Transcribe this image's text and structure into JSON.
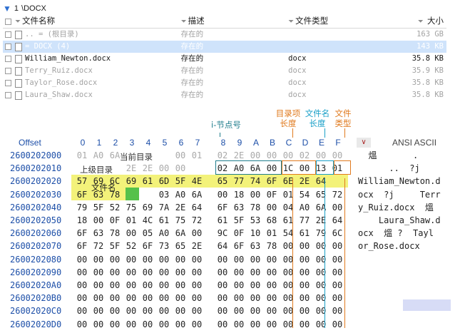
{
  "path": {
    "count": "1",
    "dir": "\\DOCX"
  },
  "list": {
    "headers": {
      "name": "文件名称",
      "desc": "描述",
      "type": "文件类型",
      "size": "大小"
    },
    "rows": [
      {
        "name": ".. = (根目录)",
        "desc": "存在的",
        "type": "",
        "size": "163 GB",
        "style": "grey"
      },
      {
        "name": "= DOCX (4)",
        "desc": "存在的",
        "type": "",
        "size": "143 KB",
        "style": "sel"
      },
      {
        "name": "William_Newton.docx",
        "desc": "存在的",
        "type": "docx",
        "size": "35.8 KB",
        "style": "normal"
      },
      {
        "name": "Terry_Ruiz.docx",
        "desc": "存在的",
        "type": "docx",
        "size": "35.9 KB",
        "style": "grey"
      },
      {
        "name": "Taylor_Rose.docx",
        "desc": "存在的",
        "type": "docx",
        "size": "35.8 KB",
        "style": "grey"
      },
      {
        "name": "Laura_Shaw.docx",
        "desc": "存在的",
        "type": "docx",
        "size": "35.8 KB",
        "style": "grey"
      }
    ]
  },
  "hex": {
    "offset_label": "Offset",
    "columns": [
      "0",
      "1",
      "2",
      "3",
      "4",
      "5",
      "6",
      "7",
      "8",
      "9",
      "A",
      "B",
      "C",
      "D",
      "E",
      "F"
    ],
    "ansi_label": "ANSI ASCII",
    "view_label": "∨",
    "rows": [
      {
        "addr": "2600202000",
        "bytes": [
          "01",
          "A0",
          "6A",
          "",
          "",
          "",
          "00",
          "01",
          "02",
          "2E",
          "00",
          "00",
          "00",
          "02",
          "00",
          "00"
        ]
      },
      {
        "addr": "2600202010",
        "bytes": [
          "",
          "",
          "",
          "2E",
          "2E",
          "00",
          "00",
          "",
          "02",
          "A0",
          "6A",
          "00",
          "1C",
          "00",
          "13",
          "01"
        ]
      },
      {
        "addr": "2600202020",
        "bytes": [
          "57",
          "69",
          "6C",
          "69",
          "61",
          "6D",
          "5F",
          "4E",
          "65",
          "77",
          "74",
          "6F",
          "6E",
          "2E",
          "64",
          ""
        ]
      },
      {
        "addr": "2600202030",
        "bytes": [
          "6F",
          "63",
          "78",
          "",
          "",
          "03",
          "A0",
          "6A",
          "00",
          "18",
          "00",
          "0F",
          "01",
          "54",
          "65",
          "72",
          "72"
        ]
      },
      {
        "addr": "2600202040",
        "bytes": [
          "79",
          "5F",
          "52",
          "75",
          "69",
          "7A",
          "2E",
          "64",
          "6F",
          "63",
          "78",
          "00",
          "04",
          "A0",
          "6A",
          "00"
        ]
      },
      {
        "addr": "2600202050",
        "bytes": [
          "18",
          "00",
          "0F",
          "01",
          "4C",
          "61",
          "75",
          "72",
          "61",
          "5F",
          "53",
          "68",
          "61",
          "77",
          "2E",
          "64"
        ]
      },
      {
        "addr": "2600202060",
        "bytes": [
          "6F",
          "63",
          "78",
          "00",
          "05",
          "A0",
          "6A",
          "00",
          "9C",
          "0F",
          "10",
          "01",
          "54",
          "61",
          "79",
          "6C"
        ]
      },
      {
        "addr": "2600202070",
        "bytes": [
          "6F",
          "72",
          "5F",
          "52",
          "6F",
          "73",
          "65",
          "2E",
          "64",
          "6F",
          "63",
          "78",
          "00",
          "00",
          "00",
          "00"
        ]
      },
      {
        "addr": "2600202080",
        "bytes": [
          "00",
          "00",
          "00",
          "00",
          "00",
          "00",
          "00",
          "00",
          "00",
          "00",
          "00",
          "00",
          "00",
          "00",
          "00",
          "00"
        ]
      },
      {
        "addr": "2600202090",
        "bytes": [
          "00",
          "00",
          "00",
          "00",
          "00",
          "00",
          "00",
          "00",
          "00",
          "00",
          "00",
          "00",
          "00",
          "00",
          "00",
          "00"
        ]
      },
      {
        "addr": "26002020A0",
        "bytes": [
          "00",
          "00",
          "00",
          "00",
          "00",
          "00",
          "00",
          "00",
          "00",
          "00",
          "00",
          "00",
          "00",
          "00",
          "00",
          "00"
        ]
      },
      {
        "addr": "26002020B0",
        "bytes": [
          "00",
          "00",
          "00",
          "00",
          "00",
          "00",
          "00",
          "00",
          "00",
          "00",
          "00",
          "00",
          "00",
          "00",
          "00",
          "00"
        ]
      },
      {
        "addr": "26002020C0",
        "bytes": [
          "00",
          "00",
          "00",
          "00",
          "00",
          "00",
          "00",
          "00",
          "00",
          "00",
          "00",
          "00",
          "00",
          "00",
          "00",
          "00"
        ]
      },
      {
        "addr": "26002020D0",
        "bytes": [
          "00",
          "00",
          "00",
          "00",
          "00",
          "00",
          "00",
          "00",
          "00",
          "00",
          "00",
          "00",
          "00",
          "00",
          "00",
          "00"
        ]
      }
    ],
    "ansi": [
      "  熅       .",
      "      ..  ?j",
      "William_Newton.d",
      "ocx  ?j     Terr",
      "y_Ruiz.docx  熅",
      "    Laura_Shaw.d",
      "ocx  熅 ?  Tayl",
      "or_Rose.docx"
    ]
  },
  "annotations": {
    "inode": "i-节点号",
    "dir_len": "目录项\n长度",
    "name_len": "文件名\n长度",
    "file_type": "文件\n类型",
    "current_dir": "当前目录",
    "parent_dir": "上级目录",
    "filename": "文件名"
  },
  "colors": {
    "inode": "#1f7d8c",
    "dir_len": "#e07a1e",
    "name_len": "#1aa0c8",
    "file_type": "#e07a1e",
    "yellow": "#f3f27a",
    "green": "#55c14b"
  }
}
